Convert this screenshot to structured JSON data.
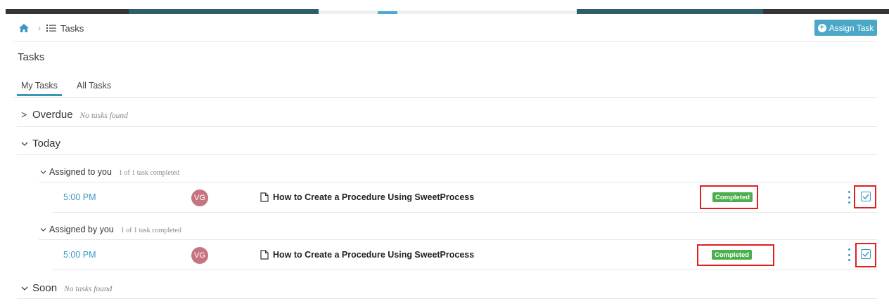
{
  "header": {
    "breadcrumb_current": "Tasks",
    "assign_button_label": "Assign Task"
  },
  "page": {
    "title": "Tasks"
  },
  "tabs": [
    {
      "label": "My Tasks",
      "active": true
    },
    {
      "label": "All Tasks",
      "active": false
    }
  ],
  "sections": {
    "overdue": {
      "name": "Overdue",
      "note": "No tasks found",
      "expanded": false
    },
    "today": {
      "name": "Today",
      "expanded": true
    },
    "soon": {
      "name": "Soon",
      "note": "No tasks found",
      "expanded": true
    }
  },
  "groups": {
    "assigned_to_you": {
      "name": "Assigned to you",
      "note": "1 of 1 task completed"
    },
    "assigned_by_you": {
      "name": "Assigned by you",
      "note": "1 of 1 task completed"
    }
  },
  "tasks": [
    {
      "time": "5:00 PM",
      "avatar": "VG",
      "title": "How to Create a Procedure Using SweetProcess",
      "status": "Completed",
      "checked": true
    },
    {
      "time": "5:00 PM",
      "avatar": "VG",
      "title": "How to Create a Procedure Using SweetProcess",
      "status": "Completed",
      "checked": true
    }
  ],
  "colors": {
    "accent": "#3a97c4",
    "button": "#4aa8c7",
    "completed_badge": "#4cae4c",
    "avatar": "#c77482",
    "highlight": "#e02020"
  },
  "icons": [
    "home-icon",
    "chevron-right-icon",
    "tasks-list-icon",
    "plus-circle-icon",
    "document-icon",
    "kebab-menu-icon",
    "checkbox-checked-icon"
  ]
}
